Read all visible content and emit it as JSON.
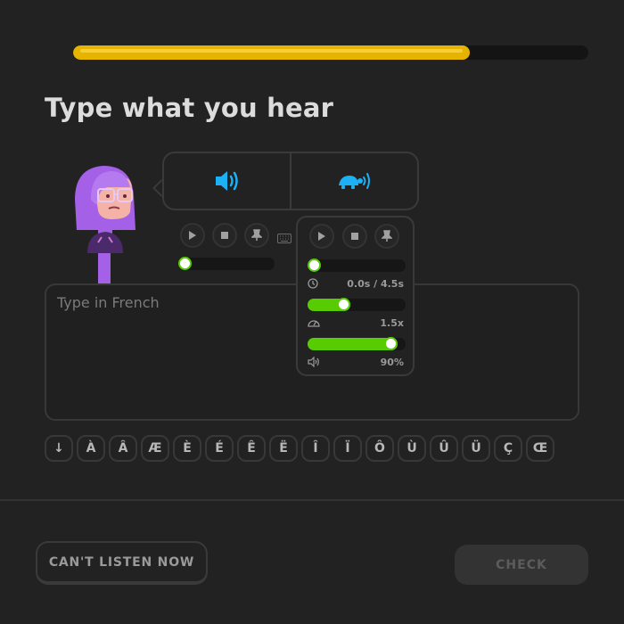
{
  "progress": {
    "fraction": 0.77,
    "color": "#e6b400"
  },
  "challenge": {
    "title": "Type what you hear"
  },
  "audio": {
    "normal_icon": "speaker-icon",
    "slow_icon": "turtle-speaker-icon",
    "accent": "#1cb0f6"
  },
  "player": {
    "position_fraction": 0.0
  },
  "popup": {
    "time_text": "0.0s / 4.5s",
    "time_fraction": 0.0,
    "speed_text": "1.5x",
    "speed_fraction": 0.35,
    "volume_text": "90%",
    "volume_fraction": 0.9,
    "accent": "#58cc02"
  },
  "answer": {
    "placeholder": "Type in French",
    "value": ""
  },
  "keyboard": {
    "toggle": "↓",
    "keys": [
      "À",
      "Â",
      "Æ",
      "È",
      "É",
      "Ê",
      "Ë",
      "Î",
      "Ï",
      "Ô",
      "Ù",
      "Û",
      "Ü",
      "Ç",
      "Œ"
    ]
  },
  "footer": {
    "skip_label": "CAN'T LISTEN NOW",
    "check_label": "CHECK"
  }
}
